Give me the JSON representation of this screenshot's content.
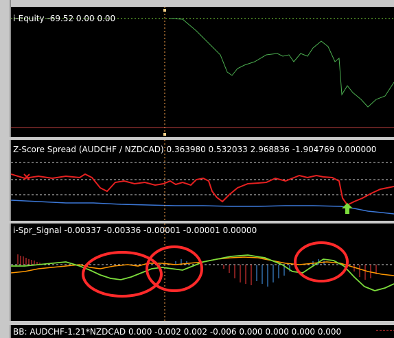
{
  "panes": {
    "equity": {
      "label": "i-Equity -69.52 0.00 0.00",
      "series": [
        {
          "name": "equity",
          "color": "#4caf50"
        }
      ]
    },
    "zscore": {
      "label": "Z-Score Spread (AUDCHF / NZDCAD) 0.363980 0.532033 2.968836 -1.904769 0.000000",
      "colors": {
        "spread": "#e62020",
        "mean": "#3c78d8",
        "levels": "#d0d0d0"
      }
    },
    "signal": {
      "label": "i-Spr_Signal -0.00337 -0.00336 -0.00001 -0.00001 0.00000",
      "colors": {
        "line_a": "#ff9800",
        "line_b": "#7cdc3c",
        "hist_pos": "#ff3b3b",
        "hist_neg": "#4aa3ff",
        "annotation": "#ff2a2a"
      }
    },
    "bb": {
      "label": "BB: AUDCHF-1.21*NZDCAD  0.000 -0.002 0.002 -0.006 0.000 0.000 0.000 0.000"
    }
  },
  "crosshair_color": "#ffa64d",
  "buy_arrow_icon": "up-arrow-icon"
}
